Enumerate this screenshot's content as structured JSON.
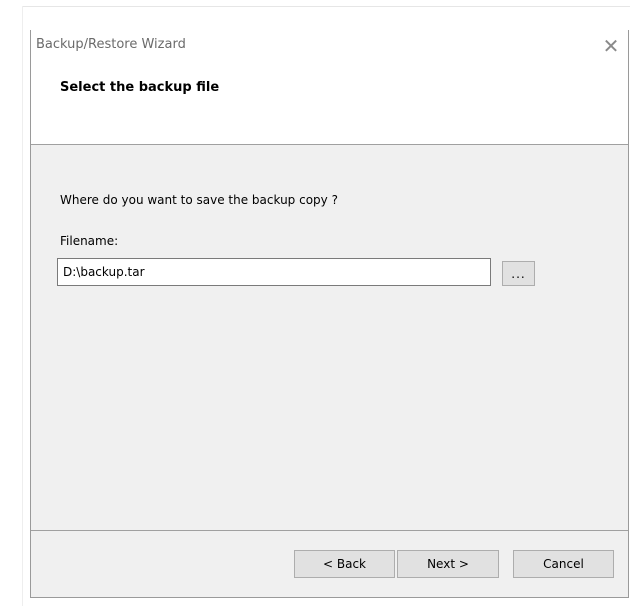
{
  "window": {
    "title": "Backup/Restore Wizard",
    "close_glyph": "✕"
  },
  "header": {
    "title": "Select the backup file"
  },
  "body": {
    "question": "Where do you want to save the backup copy ?",
    "filename_label": "Filename:",
    "filename_value": "D:\\backup.tar",
    "browse_label": "..."
  },
  "footer": {
    "back_label": "< Back",
    "next_label": "Next >",
    "cancel_label": "Cancel"
  },
  "colors": {
    "dialog_body": "#f0f0f0",
    "header_bg": "#ffffff",
    "button_bg": "#e1e1e1",
    "button_border": "#adadad"
  },
  "icons": {
    "close": "close-icon"
  }
}
